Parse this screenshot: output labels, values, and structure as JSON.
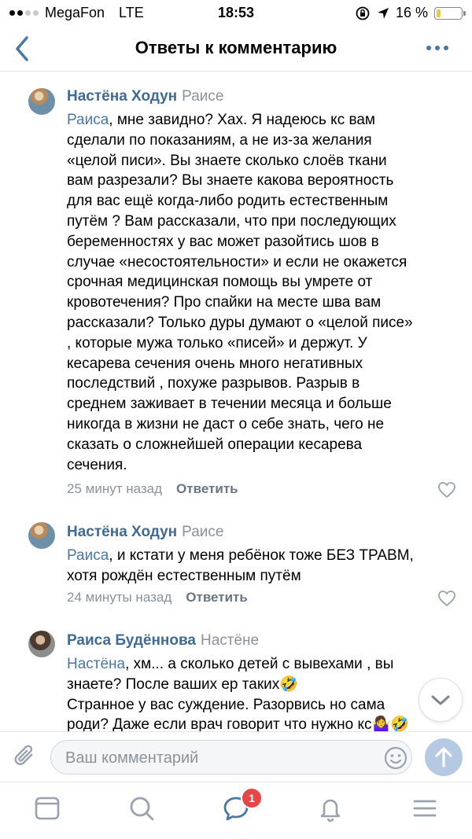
{
  "status_bar": {
    "carrier": "MegaFon",
    "network": "LTE",
    "time": "18:53",
    "battery_percent": "16 %",
    "battery_level": 0.16
  },
  "header": {
    "title": "Ответы к комментарию",
    "back_icon": "chevron-left-icon",
    "more_icon": "more-dots-icon"
  },
  "comments": [
    {
      "author": "Настёна Ходун",
      "reply_to": "Раисе",
      "mention": "Раиса",
      "text_lines": [
        ", мне завидно? Хах. Я надеюсь кс вам",
        "сделали по показаниям, а не из-за желания",
        "«целой писи». Вы знаете сколько слоёв ткани",
        "вам разрезали? Вы знаете какова вероятность",
        "для вас ещё когда-либо родить естественным",
        "путём ? Вам рассказали, что при последующих",
        "беременностях у вас может разойтись шов в",
        "случае «несостоятельности» и если не окажется",
        "срочная медицинская помощь вы умрете от",
        "кровотечения? Про спайки на месте шва вам",
        "рассказали? Только дуры думают о «целой писе»",
        ", которые мужа только «писей» и держут. У",
        "кесарева сечения очень много негативных",
        "последствий , похуже разрывов. Разрыв в",
        "среднем заживает в течении месяца и больше",
        "никогда в жизни не даст о себе знать, чего не",
        "сказать о сложнейшей операции кесарева",
        "сечения."
      ],
      "time": "25 минут назад",
      "reply_label": "Ответить"
    },
    {
      "author": "Настёна Ходун",
      "reply_to": "Раисе",
      "mention": "Раиса",
      "text_lines": [
        ", и кстати у меня ребёнок тоже БЕЗ ТРАВМ,",
        "хотя рождён естественным путём"
      ],
      "time": "24 минуты назад",
      "reply_label": "Ответить"
    },
    {
      "author": "Раиса Будённова",
      "reply_to": "Настёне",
      "mention": "Настёна",
      "text_lines": [
        ", хм... а сколько детей с вывехами , вы",
        "знаете? После ваших ер таких🤣",
        "Странное у вас суждение.  Разорвись но сама",
        "роди? Даже если врач говорит что нужно кс🤷‍♀️🤣"
      ]
    }
  ],
  "composer": {
    "placeholder": "Ваш комментарий"
  },
  "tab_bar": {
    "messages_badge": "1"
  },
  "colors": {
    "accent": "#4a76a8",
    "author_name": "#3f6a95",
    "muted": "#8b9298",
    "badge": "#e64646"
  }
}
